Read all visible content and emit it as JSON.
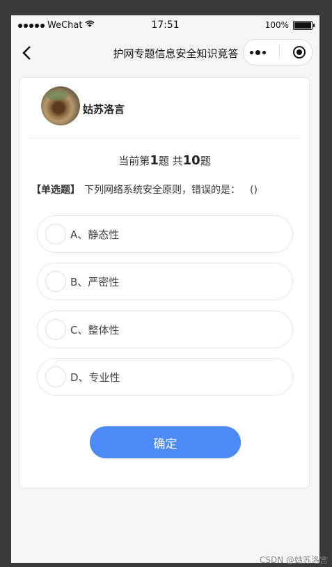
{
  "status_bar": {
    "carrier": "WeChat",
    "time": "17:51",
    "battery": "100%"
  },
  "nav": {
    "title": "护网专题信息安全知识竞答"
  },
  "user": {
    "name": "姑苏洛言"
  },
  "progress": {
    "prefix": "当前第",
    "current": "1",
    "middle": "题 共",
    "total": "10",
    "suffix": "题"
  },
  "question": {
    "type": "【单选题】",
    "text": "下列网络系统安全原则，错误的是：",
    "paren": "()"
  },
  "options": [
    {
      "label": "A、静态性"
    },
    {
      "label": "B、严密性"
    },
    {
      "label": "C、整体性"
    },
    {
      "label": "D、专业性"
    }
  ],
  "confirm_label": "确定",
  "watermark": "CSDN @姑苏洛言"
}
